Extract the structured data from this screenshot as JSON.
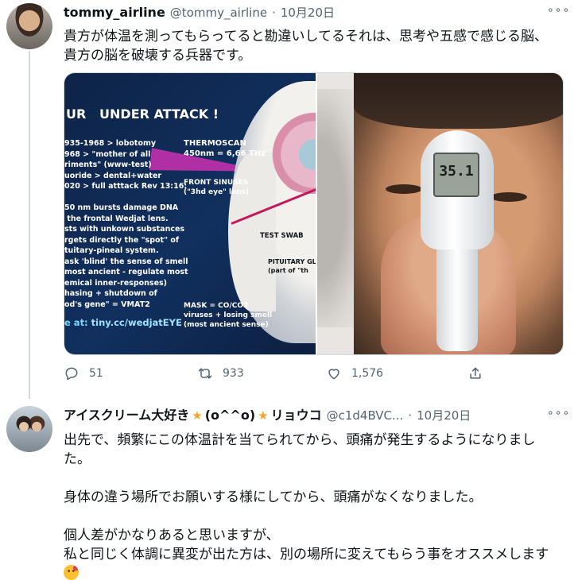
{
  "tweet1": {
    "display_name": "tommy_airline",
    "handle": "@tommy_airline",
    "separator": "·",
    "date": "10月20日",
    "more": "∘∘∘",
    "text": "貴方が体温を測ってもらってると勘違いしてるそれは、思考や五感で感じる脳、貴方の脳を破壊する兵器です。",
    "media_left": {
      "title": "UR   UNDER ATTACK !",
      "list_text": "935-1968 > lobotomy\n968 > \"mother of all\nriments\" (www-test)\nuoride > dental+water\n020 > full atttack Rev 13:16:\n\n50 nm bursts damage DNA\n the frontal Wedjat lens.\nsts with unkown substances\nrgets directly the \"spot\" of\ntuitary-pineal system.\nask 'blind' the sense of smell\nmost ancient - regulate most\nemical inner-responses)\nhasing + shutdown of\nod's gene\" = VMAT2",
      "thermoscan": "THERMOSCAN\n450nm = 6,66 THz",
      "front_sinuses": "FRONT SINUSES\n(\"3hd eye\" lens)",
      "test_swab": "TEST SWAB",
      "pituitary": "PITUITARY GL\n(part of \"th",
      "mask": "MASK = CO/CO2\nviruses + losing smell\n(most ancient sense)",
      "link_prefix": "e at: ",
      "link_url": "tiny.cc/wedjatEYE"
    },
    "thermometer_reading": "35.1",
    "actions": {
      "replies": "51",
      "retweets": "933",
      "likes": "1,576"
    }
  },
  "tweet2": {
    "display_name": "アイスクリーム大好き",
    "badge_left": "★",
    "name_middle": "(o^^o)",
    "badge_right": "★",
    "name_suffix": "リョウコ",
    "handle": "@c1d4BVC...",
    "separator": "·",
    "date": "10月20日",
    "more": "∘∘∘",
    "text": "出先で、頻繁にこの体温計を当てられてから、頭痛が発生するようになりました。\n\n身体の違う場所でお願いする様にしてから、頭痛がなくなりました。\n\n個人差がかなりあると思いますが、\n私と同じく体調に異変が出た方は、別の場所に変えてもらう事をオススメします"
  },
  "icons": [
    "reply-icon",
    "retweet-icon",
    "like-icon",
    "share-icon",
    "more-icon",
    "eye-of-horus-icon",
    "emoji-icon"
  ],
  "colors": {
    "text_primary": "#0f1419",
    "text_secondary": "#536471",
    "border": "#cfd9de",
    "infographic_bg": "#11305f"
  }
}
